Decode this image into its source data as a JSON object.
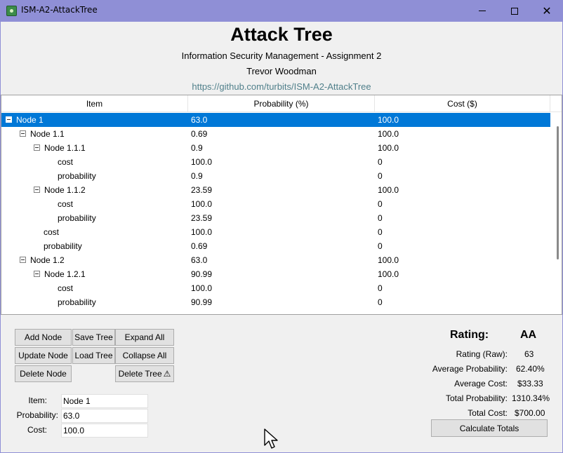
{
  "window": {
    "title": "ISM-A2-AttackTree",
    "icon": "app-tree-icon",
    "controls": {
      "minimize": "minimize-icon",
      "maximize": "maximize-icon",
      "close_glyph": "✕"
    }
  },
  "header": {
    "title": "Attack Tree",
    "subtitle": "Information Security Management - Assignment 2",
    "author": "Trevor Woodman",
    "link": "https://github.com/turbits/ISM-A2-AttackTree"
  },
  "tree": {
    "columns": [
      "Item",
      "Probability (%)",
      "Cost ($)"
    ],
    "rows": [
      {
        "label": "Node 1",
        "prob": "63.0",
        "cost": "100.0",
        "level": 0,
        "expander": true,
        "selected": true
      },
      {
        "label": "Node 1.1",
        "prob": "0.69",
        "cost": "100.0",
        "level": 1,
        "expander": true
      },
      {
        "label": "Node 1.1.1",
        "prob": "0.9",
        "cost": "100.0",
        "level": 2,
        "expander": true
      },
      {
        "label": "cost",
        "prob": "100.0",
        "cost": "0",
        "level": 3,
        "expander": false
      },
      {
        "label": "probability",
        "prob": "0.9",
        "cost": "0",
        "level": 3,
        "expander": false
      },
      {
        "label": "Node 1.1.2",
        "prob": "23.59",
        "cost": "100.0",
        "level": 2,
        "expander": true
      },
      {
        "label": "cost",
        "prob": "100.0",
        "cost": "0",
        "level": 3,
        "expander": false
      },
      {
        "label": "probability",
        "prob": "23.59",
        "cost": "0",
        "level": 3,
        "expander": false
      },
      {
        "label": "cost",
        "prob": "100.0",
        "cost": "0",
        "level": 2,
        "expander": false
      },
      {
        "label": "probability",
        "prob": "0.69",
        "cost": "0",
        "level": 2,
        "expander": false
      },
      {
        "label": "Node 1.2",
        "prob": "63.0",
        "cost": "100.0",
        "level": 1,
        "expander": true
      },
      {
        "label": "Node 1.2.1",
        "prob": "90.99",
        "cost": "100.0",
        "level": 2,
        "expander": true
      },
      {
        "label": "cost",
        "prob": "100.0",
        "cost": "0",
        "level": 3,
        "expander": false
      },
      {
        "label": "probability",
        "prob": "90.99",
        "cost": "0",
        "level": 3,
        "expander": false
      }
    ]
  },
  "buttons": {
    "add_node": "Add Node",
    "save_tree": "Save Tree",
    "expand_all": "Expand All",
    "update_node": "Update Node",
    "load_tree": "Load Tree",
    "collapse_all": "Collapse All",
    "delete_node": "Delete Node",
    "delete_tree": "Delete Tree",
    "delete_tree_icon": "⚠",
    "calculate_totals": "Calculate Totals"
  },
  "form": {
    "item_label": "Item:",
    "item_value": "Node 1",
    "probability_label": "Probability:",
    "probability_value": "63.0",
    "cost_label": "Cost:",
    "cost_value": "100.0"
  },
  "stats": {
    "rating_label": "Rating:",
    "rating_value": "AA",
    "rating_raw_label": "Rating (Raw):",
    "rating_raw_value": "63",
    "avg_prob_label": "Average Probability:",
    "avg_prob_value": "62.40%",
    "avg_cost_label": "Average Cost:",
    "avg_cost_value": "$33.33",
    "total_prob_label": "Total Probability:",
    "total_prob_value": "1310.34%",
    "total_cost_label": "Total Cost:",
    "total_cost_value": "$700.00"
  },
  "colors": {
    "titlebar": "#8f8fd6",
    "selection": "#0078d7",
    "link": "#4f7f8a"
  }
}
